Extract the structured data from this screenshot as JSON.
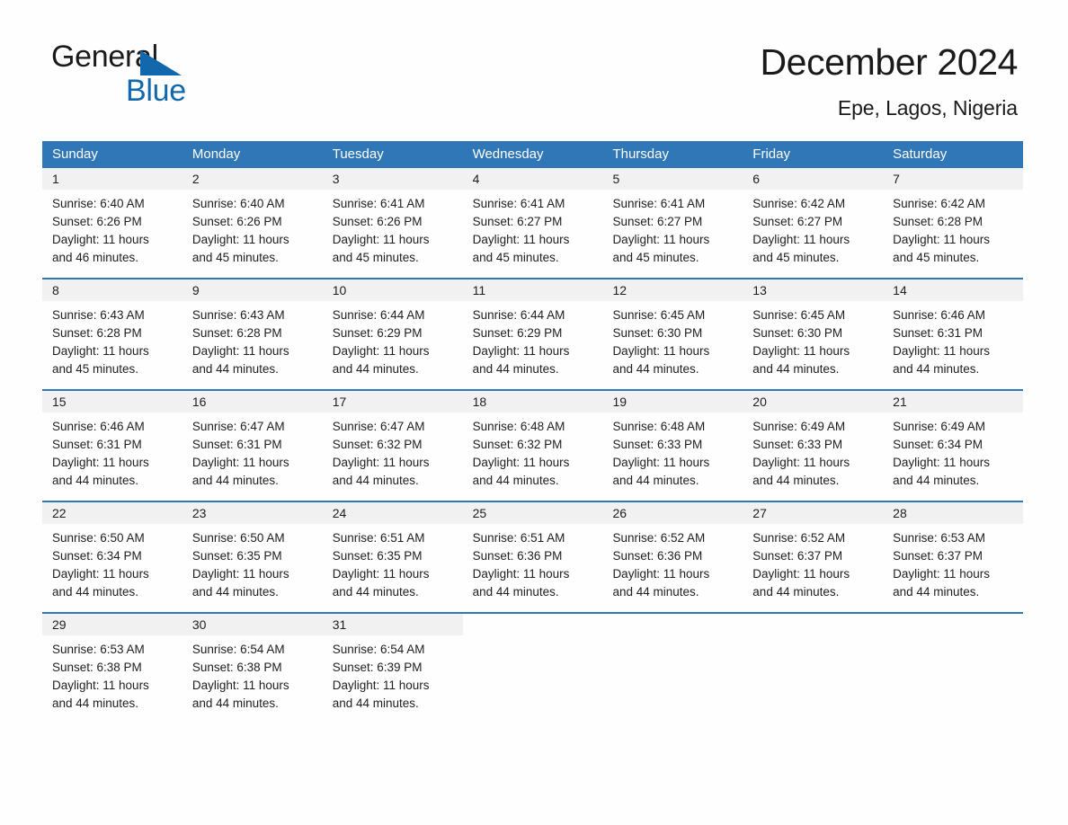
{
  "brand": {
    "name_part1": "General",
    "name_part2": "Blue",
    "triangle_icon": "triangle-icon",
    "accent_color": "#1268ad"
  },
  "header": {
    "title": "December 2024",
    "subtitle": "Epe, Lagos, Nigeria"
  },
  "theme": {
    "header_blue": "#2f77b6",
    "date_strip_gray": "#f1f1f1",
    "text_color": "#1e1e1e",
    "page_background": "#fefefe"
  },
  "calendar": {
    "weekday_headers": [
      "Sunday",
      "Monday",
      "Tuesday",
      "Wednesday",
      "Thursday",
      "Friday",
      "Saturday"
    ],
    "labels": {
      "sunrise": "Sunrise:",
      "sunset": "Sunset:",
      "daylight": "Daylight:"
    },
    "weeks": [
      {
        "days": [
          {
            "date": "1",
            "sunrise_line": "Sunrise: 6:40 AM",
            "sunset_line": "Sunset: 6:26 PM",
            "daylight_line1": "Daylight: 11 hours",
            "daylight_line2": "and 46 minutes.",
            "sunrise": "6:40 AM",
            "sunset": "6:26 PM",
            "daylight": "11 hours and 46 minutes."
          },
          {
            "date": "2",
            "sunrise_line": "Sunrise: 6:40 AM",
            "sunset_line": "Sunset: 6:26 PM",
            "daylight_line1": "Daylight: 11 hours",
            "daylight_line2": "and 45 minutes.",
            "sunrise": "6:40 AM",
            "sunset": "6:26 PM",
            "daylight": "11 hours and 45 minutes."
          },
          {
            "date": "3",
            "sunrise_line": "Sunrise: 6:41 AM",
            "sunset_line": "Sunset: 6:26 PM",
            "daylight_line1": "Daylight: 11 hours",
            "daylight_line2": "and 45 minutes.",
            "sunrise": "6:41 AM",
            "sunset": "6:26 PM",
            "daylight": "11 hours and 45 minutes."
          },
          {
            "date": "4",
            "sunrise_line": "Sunrise: 6:41 AM",
            "sunset_line": "Sunset: 6:27 PM",
            "daylight_line1": "Daylight: 11 hours",
            "daylight_line2": "and 45 minutes.",
            "sunrise": "6:41 AM",
            "sunset": "6:27 PM",
            "daylight": "11 hours and 45 minutes."
          },
          {
            "date": "5",
            "sunrise_line": "Sunrise: 6:41 AM",
            "sunset_line": "Sunset: 6:27 PM",
            "daylight_line1": "Daylight: 11 hours",
            "daylight_line2": "and 45 minutes.",
            "sunrise": "6:41 AM",
            "sunset": "6:27 PM",
            "daylight": "11 hours and 45 minutes."
          },
          {
            "date": "6",
            "sunrise_line": "Sunrise: 6:42 AM",
            "sunset_line": "Sunset: 6:27 PM",
            "daylight_line1": "Daylight: 11 hours",
            "daylight_line2": "and 45 minutes.",
            "sunrise": "6:42 AM",
            "sunset": "6:27 PM",
            "daylight": "11 hours and 45 minutes."
          },
          {
            "date": "7",
            "sunrise_line": "Sunrise: 6:42 AM",
            "sunset_line": "Sunset: 6:28 PM",
            "daylight_line1": "Daylight: 11 hours",
            "daylight_line2": "and 45 minutes.",
            "sunrise": "6:42 AM",
            "sunset": "6:28 PM",
            "daylight": "11 hours and 45 minutes."
          }
        ]
      },
      {
        "days": [
          {
            "date": "8",
            "sunrise_line": "Sunrise: 6:43 AM",
            "sunset_line": "Sunset: 6:28 PM",
            "daylight_line1": "Daylight: 11 hours",
            "daylight_line2": "and 45 minutes.",
            "sunrise": "6:43 AM",
            "sunset": "6:28 PM",
            "daylight": "11 hours and 45 minutes."
          },
          {
            "date": "9",
            "sunrise_line": "Sunrise: 6:43 AM",
            "sunset_line": "Sunset: 6:28 PM",
            "daylight_line1": "Daylight: 11 hours",
            "daylight_line2": "and 44 minutes.",
            "sunrise": "6:43 AM",
            "sunset": "6:28 PM",
            "daylight": "11 hours and 44 minutes."
          },
          {
            "date": "10",
            "sunrise_line": "Sunrise: 6:44 AM",
            "sunset_line": "Sunset: 6:29 PM",
            "daylight_line1": "Daylight: 11 hours",
            "daylight_line2": "and 44 minutes.",
            "sunrise": "6:44 AM",
            "sunset": "6:29 PM",
            "daylight": "11 hours and 44 minutes."
          },
          {
            "date": "11",
            "sunrise_line": "Sunrise: 6:44 AM",
            "sunset_line": "Sunset: 6:29 PM",
            "daylight_line1": "Daylight: 11 hours",
            "daylight_line2": "and 44 minutes.",
            "sunrise": "6:44 AM",
            "sunset": "6:29 PM",
            "daylight": "11 hours and 44 minutes."
          },
          {
            "date": "12",
            "sunrise_line": "Sunrise: 6:45 AM",
            "sunset_line": "Sunset: 6:30 PM",
            "daylight_line1": "Daylight: 11 hours",
            "daylight_line2": "and 44 minutes.",
            "sunrise": "6:45 AM",
            "sunset": "6:30 PM",
            "daylight": "11 hours and 44 minutes."
          },
          {
            "date": "13",
            "sunrise_line": "Sunrise: 6:45 AM",
            "sunset_line": "Sunset: 6:30 PM",
            "daylight_line1": "Daylight: 11 hours",
            "daylight_line2": "and 44 minutes.",
            "sunrise": "6:45 AM",
            "sunset": "6:30 PM",
            "daylight": "11 hours and 44 minutes."
          },
          {
            "date": "14",
            "sunrise_line": "Sunrise: 6:46 AM",
            "sunset_line": "Sunset: 6:31 PM",
            "daylight_line1": "Daylight: 11 hours",
            "daylight_line2": "and 44 minutes.",
            "sunrise": "6:46 AM",
            "sunset": "6:31 PM",
            "daylight": "11 hours and 44 minutes."
          }
        ]
      },
      {
        "days": [
          {
            "date": "15",
            "sunrise_line": "Sunrise: 6:46 AM",
            "sunset_line": "Sunset: 6:31 PM",
            "daylight_line1": "Daylight: 11 hours",
            "daylight_line2": "and 44 minutes.",
            "sunrise": "6:46 AM",
            "sunset": "6:31 PM",
            "daylight": "11 hours and 44 minutes."
          },
          {
            "date": "16",
            "sunrise_line": "Sunrise: 6:47 AM",
            "sunset_line": "Sunset: 6:31 PM",
            "daylight_line1": "Daylight: 11 hours",
            "daylight_line2": "and 44 minutes.",
            "sunrise": "6:47 AM",
            "sunset": "6:31 PM",
            "daylight": "11 hours and 44 minutes."
          },
          {
            "date": "17",
            "sunrise_line": "Sunrise: 6:47 AM",
            "sunset_line": "Sunset: 6:32 PM",
            "daylight_line1": "Daylight: 11 hours",
            "daylight_line2": "and 44 minutes.",
            "sunrise": "6:47 AM",
            "sunset": "6:32 PM",
            "daylight": "11 hours and 44 minutes."
          },
          {
            "date": "18",
            "sunrise_line": "Sunrise: 6:48 AM",
            "sunset_line": "Sunset: 6:32 PM",
            "daylight_line1": "Daylight: 11 hours",
            "daylight_line2": "and 44 minutes.",
            "sunrise": "6:48 AM",
            "sunset": "6:32 PM",
            "daylight": "11 hours and 44 minutes."
          },
          {
            "date": "19",
            "sunrise_line": "Sunrise: 6:48 AM",
            "sunset_line": "Sunset: 6:33 PM",
            "daylight_line1": "Daylight: 11 hours",
            "daylight_line2": "and 44 minutes.",
            "sunrise": "6:48 AM",
            "sunset": "6:33 PM",
            "daylight": "11 hours and 44 minutes."
          },
          {
            "date": "20",
            "sunrise_line": "Sunrise: 6:49 AM",
            "sunset_line": "Sunset: 6:33 PM",
            "daylight_line1": "Daylight: 11 hours",
            "daylight_line2": "and 44 minutes.",
            "sunrise": "6:49 AM",
            "sunset": "6:33 PM",
            "daylight": "11 hours and 44 minutes."
          },
          {
            "date": "21",
            "sunrise_line": "Sunrise: 6:49 AM",
            "sunset_line": "Sunset: 6:34 PM",
            "daylight_line1": "Daylight: 11 hours",
            "daylight_line2": "and 44 minutes.",
            "sunrise": "6:49 AM",
            "sunset": "6:34 PM",
            "daylight": "11 hours and 44 minutes."
          }
        ]
      },
      {
        "days": [
          {
            "date": "22",
            "sunrise_line": "Sunrise: 6:50 AM",
            "sunset_line": "Sunset: 6:34 PM",
            "daylight_line1": "Daylight: 11 hours",
            "daylight_line2": "and 44 minutes.",
            "sunrise": "6:50 AM",
            "sunset": "6:34 PM",
            "daylight": "11 hours and 44 minutes."
          },
          {
            "date": "23",
            "sunrise_line": "Sunrise: 6:50 AM",
            "sunset_line": "Sunset: 6:35 PM",
            "daylight_line1": "Daylight: 11 hours",
            "daylight_line2": "and 44 minutes.",
            "sunrise": "6:50 AM",
            "sunset": "6:35 PM",
            "daylight": "11 hours and 44 minutes."
          },
          {
            "date": "24",
            "sunrise_line": "Sunrise: 6:51 AM",
            "sunset_line": "Sunset: 6:35 PM",
            "daylight_line1": "Daylight: 11 hours",
            "daylight_line2": "and 44 minutes.",
            "sunrise": "6:51 AM",
            "sunset": "6:35 PM",
            "daylight": "11 hours and 44 minutes."
          },
          {
            "date": "25",
            "sunrise_line": "Sunrise: 6:51 AM",
            "sunset_line": "Sunset: 6:36 PM",
            "daylight_line1": "Daylight: 11 hours",
            "daylight_line2": "and 44 minutes.",
            "sunrise": "6:51 AM",
            "sunset": "6:36 PM",
            "daylight": "11 hours and 44 minutes."
          },
          {
            "date": "26",
            "sunrise_line": "Sunrise: 6:52 AM",
            "sunset_line": "Sunset: 6:36 PM",
            "daylight_line1": "Daylight: 11 hours",
            "daylight_line2": "and 44 minutes.",
            "sunrise": "6:52 AM",
            "sunset": "6:36 PM",
            "daylight": "11 hours and 44 minutes."
          },
          {
            "date": "27",
            "sunrise_line": "Sunrise: 6:52 AM",
            "sunset_line": "Sunset: 6:37 PM",
            "daylight_line1": "Daylight: 11 hours",
            "daylight_line2": "and 44 minutes.",
            "sunrise": "6:52 AM",
            "sunset": "6:37 PM",
            "daylight": "11 hours and 44 minutes."
          },
          {
            "date": "28",
            "sunrise_line": "Sunrise: 6:53 AM",
            "sunset_line": "Sunset: 6:37 PM",
            "daylight_line1": "Daylight: 11 hours",
            "daylight_line2": "and 44 minutes.",
            "sunrise": "6:53 AM",
            "sunset": "6:37 PM",
            "daylight": "11 hours and 44 minutes."
          }
        ]
      },
      {
        "days": [
          {
            "date": "29",
            "sunrise_line": "Sunrise: 6:53 AM",
            "sunset_line": "Sunset: 6:38 PM",
            "daylight_line1": "Daylight: 11 hours",
            "daylight_line2": "and 44 minutes.",
            "sunrise": "6:53 AM",
            "sunset": "6:38 PM",
            "daylight": "11 hours and 44 minutes."
          },
          {
            "date": "30",
            "sunrise_line": "Sunrise: 6:54 AM",
            "sunset_line": "Sunset: 6:38 PM",
            "daylight_line1": "Daylight: 11 hours",
            "daylight_line2": "and 44 minutes.",
            "sunrise": "6:54 AM",
            "sunset": "6:38 PM",
            "daylight": "11 hours and 44 minutes."
          },
          {
            "date": "31",
            "sunrise_line": "Sunrise: 6:54 AM",
            "sunset_line": "Sunset: 6:39 PM",
            "daylight_line1": "Daylight: 11 hours",
            "daylight_line2": "and 44 minutes.",
            "sunrise": "6:54 AM",
            "sunset": "6:39 PM",
            "daylight": "11 hours and 44 minutes."
          },
          {
            "date": "",
            "sunrise_line": "",
            "sunset_line": "",
            "daylight_line1": "",
            "daylight_line2": "",
            "empty": true
          },
          {
            "date": "",
            "sunrise_line": "",
            "sunset_line": "",
            "daylight_line1": "",
            "daylight_line2": "",
            "empty": true
          },
          {
            "date": "",
            "sunrise_line": "",
            "sunset_line": "",
            "daylight_line1": "",
            "daylight_line2": "",
            "empty": true
          },
          {
            "date": "",
            "sunrise_line": "",
            "sunset_line": "",
            "daylight_line1": "",
            "daylight_line2": "",
            "empty": true
          }
        ]
      }
    ]
  }
}
